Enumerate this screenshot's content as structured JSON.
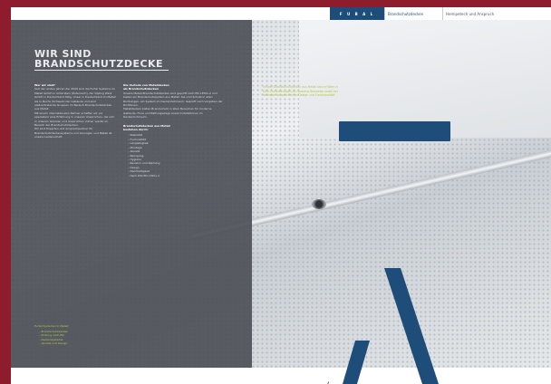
{
  "header": {
    "brand": "F U B A L",
    "nav": [
      "Brandschutzdecken",
      "Hemipetech und Anspruch"
    ]
  },
  "title": {
    "line1": "WIR SIND",
    "line2": "BRANDSCHUTZDECKE"
  },
  "col1": {
    "heading": "Wer wir sind?",
    "p1": "Seit den ersten Jahren der 2009 sind die Furtal Systeme im Metall GmbH in Unterstein (Österreich), der Dipling Werk GmbH in Deutschland tätig. Unser in Deutschland im Metall AG in Buchs (Schweiz) der Gebäude und sind stellvertretende Gruppen im Bereich Brandschutzdecken aus Metall.",
    "p2": "Mit einem internationalen Partner schaffen wir vor speziellem eine Erfahrung in unseren Ansprüchen, die sich in unseren Grenzen und Ansprüchen immer wieder im Bereich der Brandschutzdecken.",
    "p3": "Wir sind Experten und Ansprechpartner für Brandschutzdeckensysteme und Lösungen und Metall ist unsere Leidenschaft."
  },
  "col2": {
    "heading1": "Die Vorteile von Metalldecken",
    "heading2": "als Brandschutzdecken",
    "p1": "Unsere Metall-Brandschutzdecken sind geprüft nach EN 13501-2 und bieten ein Brandschutzsystem aus Metall. Sie sind Schutz in allen Richtungen, ein System im Deckenhohlraum. Geprüft nach Vorgaben der Richtlinien.",
    "p2": "Metalldecken bieten Brandschutz in allen Bereichen für moderne Gebäude, Flure und Rettungswege sowie Installationen im Deckenhohlraum.",
    "heading3": "Brandschutzdecken aus Metall",
    "heading4": "bestehen durch:",
    "list": [
      "Stabilität",
      "Formvielfalt",
      "Langlebigkeit",
      "Montage",
      "Akustik",
      "Reinigung",
      "Hygiene",
      "Revision und Wartung",
      "Design",
      "Nachhaltigkeit",
      "Nach DIN EN 13501-2"
    ]
  },
  "col3": "Unsere Brandschutzdecken aus Metall sind erfüllen in allen Anforderungen an moderne Bauweise sowie bei höchsten Ansprüchen an Design und Funktionalität.",
  "footnote": {
    "heading": "Furtal Systeme im Metall",
    "items": [
      "Brandschutzdecken",
      "Prüfung nach EN",
      "Deckensysteme",
      "Akustik und Design"
    ]
  },
  "page_number": "4"
}
